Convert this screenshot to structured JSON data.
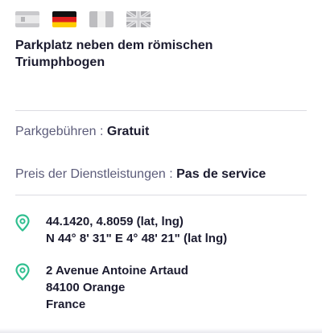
{
  "languages": [
    {
      "code": "es",
      "icon": "flag-spain-icon"
    },
    {
      "code": "de",
      "icon": "flag-germany-icon"
    },
    {
      "code": "it",
      "icon": "flag-italy-icon"
    },
    {
      "code": "en",
      "icon": "flag-uk-icon"
    }
  ],
  "place": {
    "title": "Parkplatz neben dem römischen Triumphbogen"
  },
  "fees": {
    "label": "Parkgebühren",
    "separator": ":",
    "value": "Gratuit"
  },
  "services": {
    "label": "Preis der Dienstleistungen",
    "separator": ":",
    "value": "Pas de service"
  },
  "coordinates": {
    "icon": "location-pin-icon",
    "decimal": "44.1420, 4.8059 (lat, lng)",
    "dms": "N 44° 8' 31\" E 4° 48' 21\" (lat lng)"
  },
  "address": {
    "icon": "location-pin-icon",
    "street": "2 Avenue Antoine Artaud",
    "city": "84100 Orange",
    "country": "France"
  },
  "colors": {
    "accent": "#2fbf8f",
    "label": "#5c5c7a",
    "text": "#1b1b2f",
    "divider": "#dcdce2"
  }
}
